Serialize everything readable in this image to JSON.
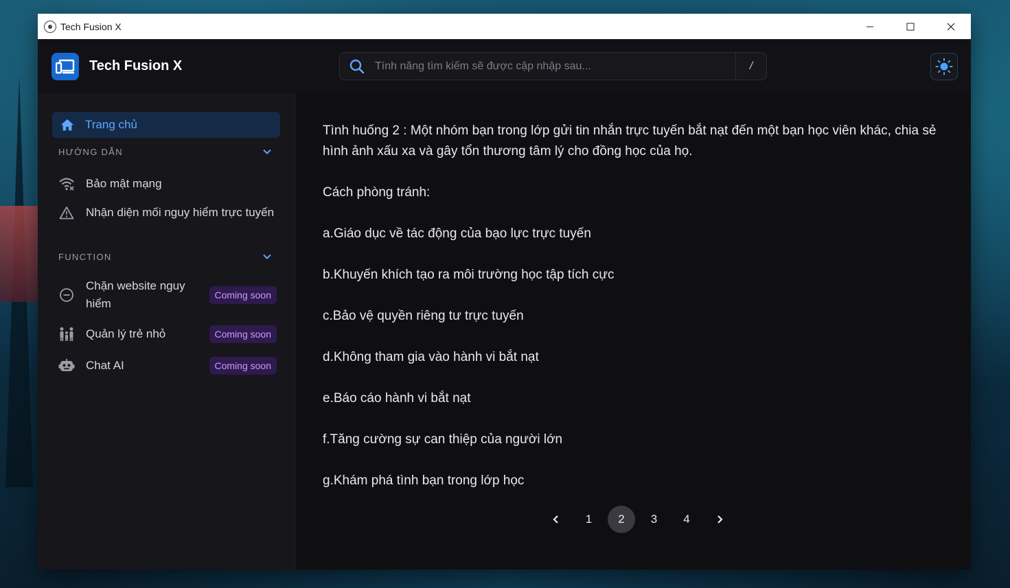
{
  "window": {
    "title": "Tech Fusion X"
  },
  "header": {
    "brand": "Tech Fusion X",
    "search_placeholder": "Tính năng tìm kiếm sẽ được cập nhập sau...",
    "search_shortcut": "/"
  },
  "sidebar": {
    "home_label": "Trang chủ",
    "sections": [
      {
        "title": "HƯỚNG DẪN",
        "items": [
          {
            "label": "Bảo mật mạng",
            "icon": "wifi-icon"
          },
          {
            "label": "Nhận diện mối nguy hiểm trực tuyến",
            "icon": "warning-icon"
          }
        ]
      },
      {
        "title": "FUNCTION",
        "items": [
          {
            "label": "Chặn website nguy hiểm",
            "icon": "block-icon",
            "badge": "Coming soon"
          },
          {
            "label": "Quản lý trẻ nhỏ",
            "icon": "family-icon",
            "badge": "Coming soon"
          },
          {
            "label": "Chat AI",
            "icon": "robot-icon",
            "badge": "Coming soon"
          }
        ]
      }
    ]
  },
  "main": {
    "paragraphs": [
      "Tình huống 2 : Một nhóm bạn trong lớp gửi tin nhắn trực tuyến bắt nạt đến một bạn học viên khác, chia sẻ hình ảnh xấu xa và gây tổn thương tâm lý cho đồng học của họ.",
      "Cách phòng tránh:",
      "a.Giáo dục về tác động của bạo lực trực tuyến",
      "b.Khuyến khích tạo ra môi trường học tập tích cực",
      "c.Bảo vệ quyền riêng tư trực tuyến",
      "d.Không tham gia vào hành vi bắt nạt",
      "e.Báo cáo hành vi bắt nạt",
      "f.Tăng cường sự can thiệp của người lớn",
      "g.Khám phá tình bạn trong lớp học"
    ],
    "pagination": {
      "pages": [
        "1",
        "2",
        "3",
        "4"
      ],
      "current": "2"
    }
  },
  "colors": {
    "accent": "#1769d0",
    "home_active_bg": "#152a47",
    "badge_bg": "#2f1a4d",
    "badge_text": "#c89bff"
  }
}
